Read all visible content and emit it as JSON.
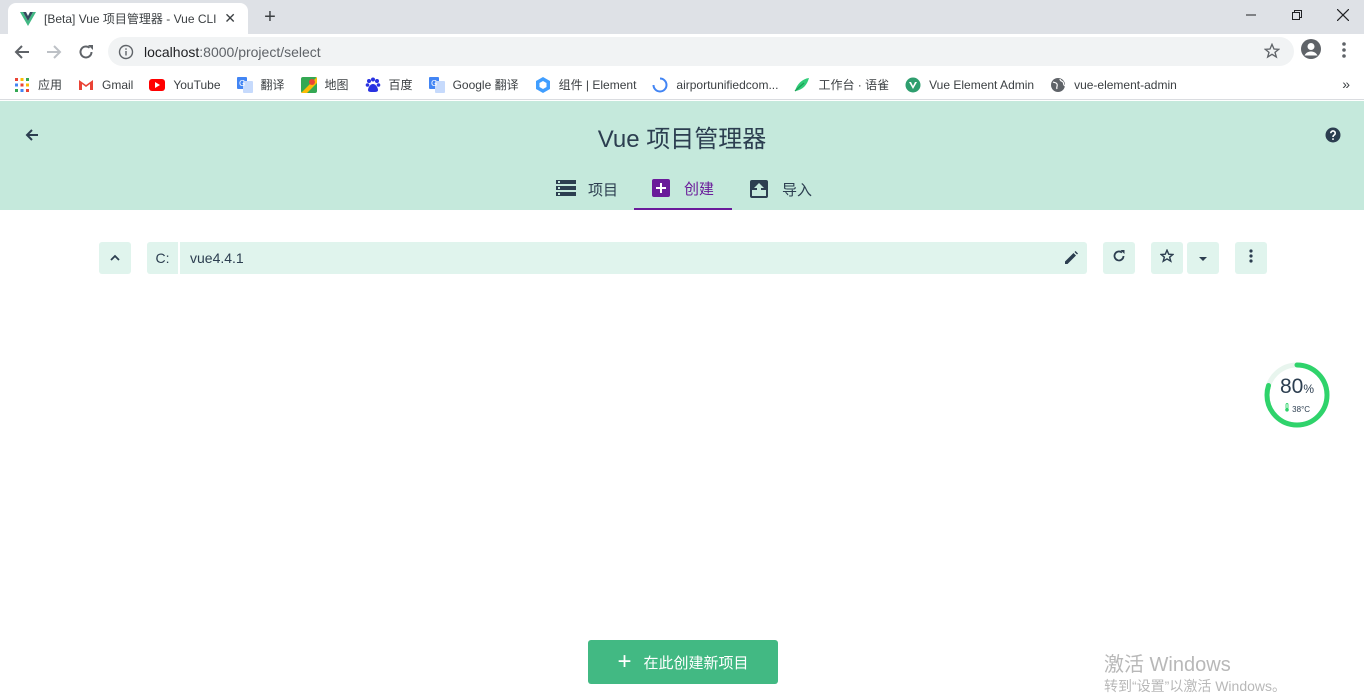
{
  "browser": {
    "tab_title": "[Beta] Vue 项目管理器 - Vue CLI",
    "new_tab": "+",
    "url_host": "localhost",
    "url_rest": ":8000/project/select",
    "bookmarks": [
      {
        "label": "应用",
        "icon": "apps-grid-icon"
      },
      {
        "label": "Gmail",
        "icon": "gmail-icon"
      },
      {
        "label": "YouTube",
        "icon": "youtube-icon"
      },
      {
        "label": "翻译",
        "icon": "translate-icon"
      },
      {
        "label": "地图",
        "icon": "maps-icon"
      },
      {
        "label": "百度",
        "icon": "baidu-icon"
      },
      {
        "label": "Google 翻译",
        "icon": "google-translate-icon"
      },
      {
        "label": "组件 | Element",
        "icon": "element-icon"
      },
      {
        "label": "airportunifiedcom...",
        "icon": "loading-icon"
      },
      {
        "label": "工作台 · 语雀",
        "icon": "yuque-icon"
      },
      {
        "label": "Vue Element Admin",
        "icon": "vue-icon"
      },
      {
        "label": "vue-element-admin",
        "icon": "globe-icon"
      }
    ],
    "bookmarks_more": "»"
  },
  "app": {
    "title": "Vue 项目管理器",
    "tabs": [
      {
        "label": "项目",
        "icon": "list-icon"
      },
      {
        "label": "创建",
        "icon": "add-box-icon"
      },
      {
        "label": "导入",
        "icon": "import-icon"
      }
    ],
    "active_tab": "创建"
  },
  "path": {
    "drive": "C:",
    "folder": "vue4.4.1"
  },
  "widget": {
    "percent": "80",
    "percent_sign": "%",
    "temperature": "38°C",
    "level": 0.8
  },
  "create_button": {
    "label": "在此创建新项目"
  },
  "watermark": {
    "line1": "激活 Windows",
    "line2": "转到“设置”以激活 Windows。"
  },
  "colors": {
    "header_bg": "#c5e9dc",
    "accent": "#42b983",
    "active_tab": "#6a1b9a",
    "field_bg": "#e0f4ed"
  }
}
